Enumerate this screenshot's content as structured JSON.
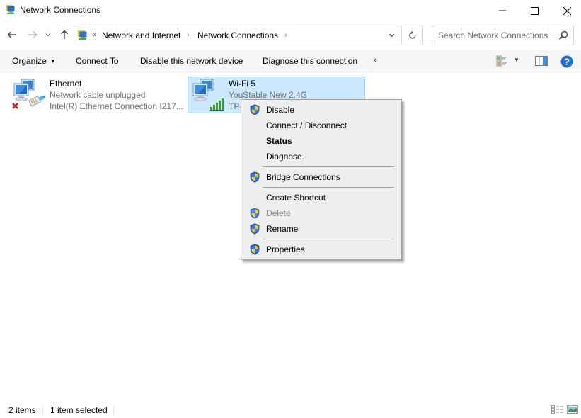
{
  "window": {
    "title": "Network Connections",
    "controls": {
      "minimize": "minimize",
      "maximize": "maximize",
      "close": "close"
    }
  },
  "address_bar": {
    "overflow_glyph": "«",
    "breadcrumbs": [
      "Network and Internet",
      "Network Connections"
    ],
    "separator": "›"
  },
  "search": {
    "placeholder": "Search Network Connections"
  },
  "command_bar": {
    "organize": "Organize",
    "connect_to": "Connect To",
    "disable_device": "Disable this network device",
    "diagnose": "Diagnose this connection",
    "more": "»"
  },
  "connections": [
    {
      "name": "Ethernet",
      "status": "Network cable unplugged",
      "device": "Intel(R) Ethernet Connection I217...",
      "selected": false,
      "icon": "ethernet-disconnected-icon"
    },
    {
      "name": "Wi-Fi 5",
      "status": "YouStable New 2.4G",
      "device": "TP-",
      "selected": true,
      "icon": "wifi-connected-icon"
    }
  ],
  "context_menu": {
    "items": [
      {
        "label": "Disable",
        "shield": true,
        "bold": false,
        "disabled": false
      },
      {
        "label": "Connect / Disconnect",
        "shield": false,
        "bold": false,
        "disabled": false
      },
      {
        "label": "Status",
        "shield": false,
        "bold": true,
        "disabled": false
      },
      {
        "label": "Diagnose",
        "shield": false,
        "bold": false,
        "disabled": false
      },
      {
        "label": "Bridge Connections",
        "shield": true,
        "bold": false,
        "disabled": false
      },
      {
        "label": "Create Shortcut",
        "shield": false,
        "bold": false,
        "disabled": false
      },
      {
        "label": "Delete",
        "shield": true,
        "bold": false,
        "disabled": true
      },
      {
        "label": "Rename",
        "shield": true,
        "bold": false,
        "disabled": false
      },
      {
        "label": "Properties",
        "shield": true,
        "bold": false,
        "disabled": false
      }
    ]
  },
  "status_bar": {
    "item_count": "2 items",
    "selection": "1 item selected"
  },
  "colors": {
    "selection_bg": "#cce8ff",
    "selection_border": "#99d1ff",
    "menu_bg": "#eeeeee",
    "help_blue": "#1e6fd9",
    "signal_green": "#3c9a3c"
  }
}
